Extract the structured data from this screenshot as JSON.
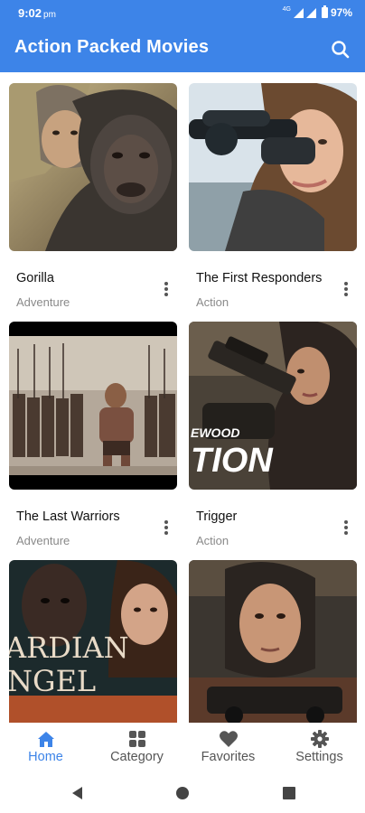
{
  "status_bar": {
    "time": "9:02",
    "ampm": "pm",
    "network": "4G",
    "battery": "97%"
  },
  "app_bar": {
    "title": "Action Packed Movies",
    "search_icon": "search-icon"
  },
  "movies": [
    {
      "title": "Gorilla",
      "genre": "Adventure"
    },
    {
      "title": "The First Responders",
      "genre": "Action"
    },
    {
      "title": "The Last Warriors",
      "genre": "Adventure"
    },
    {
      "title": "Trigger",
      "genre": "Action",
      "poster_text": "EWOOD\nTION"
    },
    {
      "title": "",
      "genre": "",
      "poster_text": "ARDIAN\nNGEL"
    },
    {
      "title": "",
      "genre": ""
    }
  ],
  "bottom_nav": {
    "items": [
      {
        "label": "Home",
        "icon": "home-icon",
        "active": true
      },
      {
        "label": "Category",
        "icon": "category-icon",
        "active": false
      },
      {
        "label": "Favorites",
        "icon": "heart-icon",
        "active": false
      },
      {
        "label": "Settings",
        "icon": "gear-icon",
        "active": false
      }
    ]
  },
  "system_nav": {
    "back": "back-icon",
    "home": "home-circle-icon",
    "recents": "recents-icon"
  },
  "colors": {
    "primary": "#3d84e8",
    "text_primary": "#111111",
    "text_secondary": "#8a8a8a"
  }
}
